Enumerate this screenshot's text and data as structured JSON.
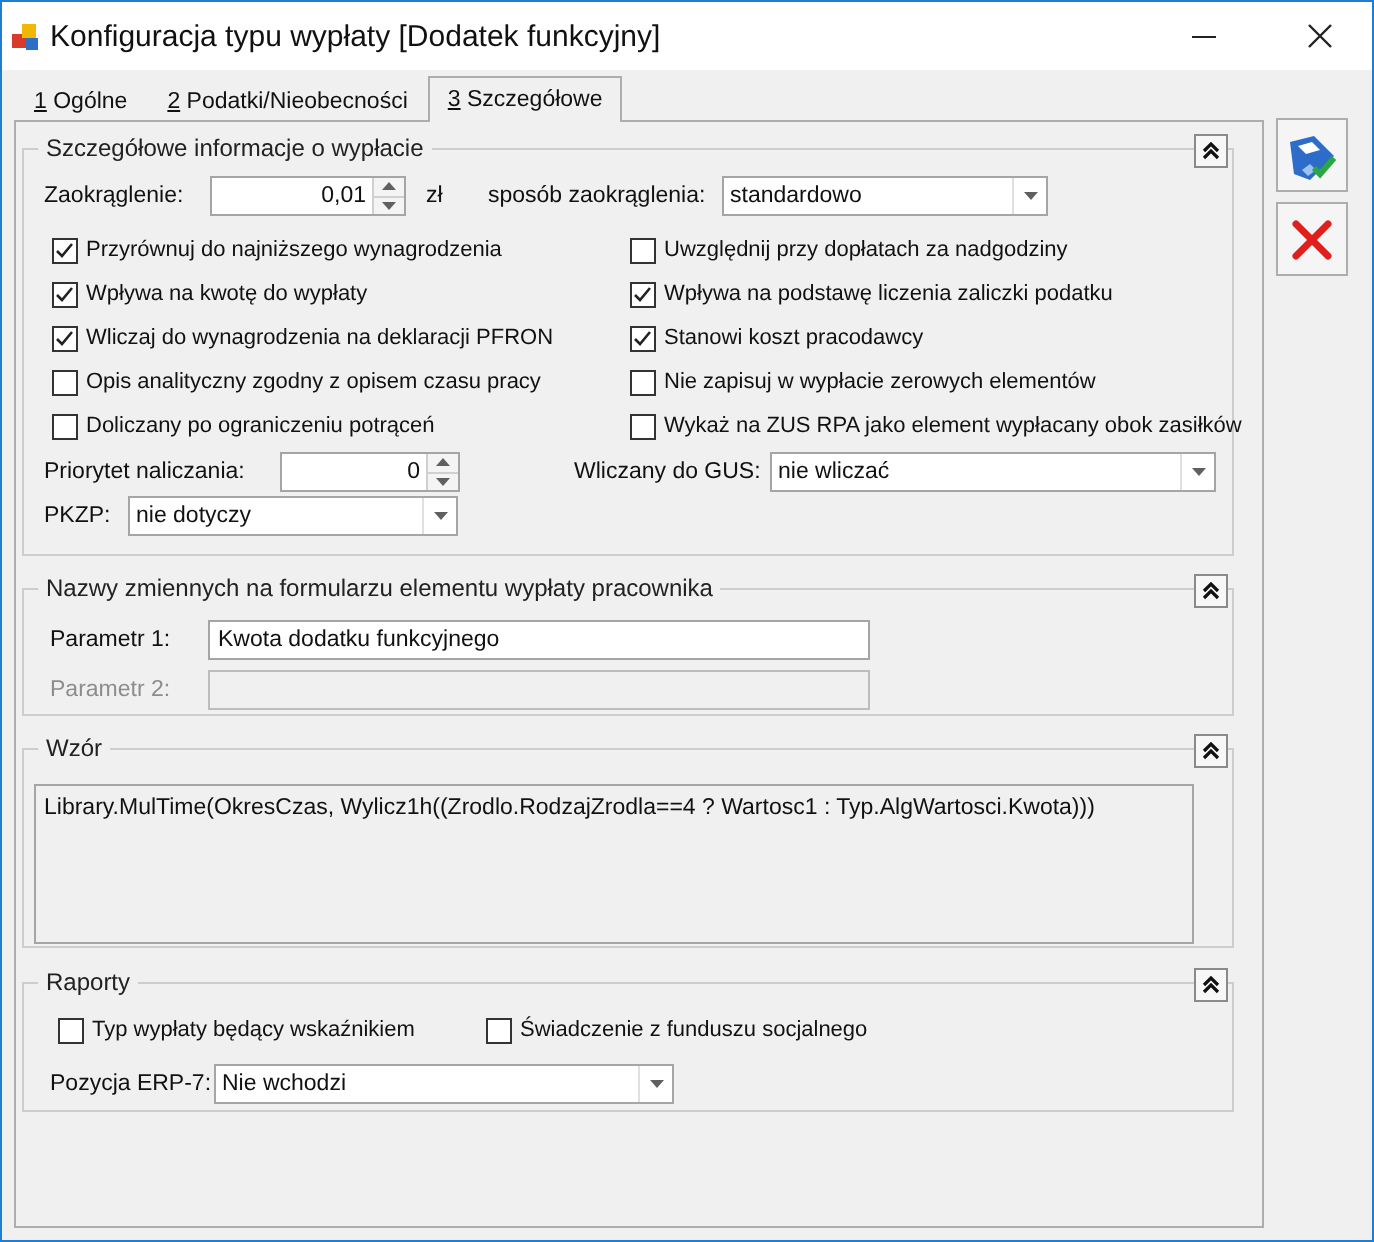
{
  "window": {
    "title": "Konfiguracja typu wypłaty [Dodatek funkcyjny]"
  },
  "tabs": [
    {
      "key": "1",
      "label": "Ogólne",
      "selected": false
    },
    {
      "key": "2",
      "label": "Podatki/Nieobecności",
      "selected": false
    },
    {
      "key": "3",
      "label": "Szczegółowe",
      "selected": true
    }
  ],
  "details": {
    "title": "Szczegółowe informacje o wypłacie",
    "rounding": {
      "label": "Zaokrąglenie:",
      "value": "0,01",
      "unit": "zł"
    },
    "rounding_mode": {
      "label": "sposób zaokrąglenia:",
      "value": "standardowo"
    },
    "options": [
      {
        "label": "Przyrównuj do najniższego wynagrodzenia",
        "checked": true
      },
      {
        "label": "Uwzględnij przy dopłatach za nadgodziny",
        "checked": false
      },
      {
        "label": "Wpływa na kwotę do wypłaty",
        "checked": true
      },
      {
        "label": "Wpływa na podstawę liczenia zaliczki podatku",
        "checked": true
      },
      {
        "label": "Wliczaj do wynagrodzenia na deklaracji PFRON",
        "checked": true
      },
      {
        "label": "Stanowi koszt pracodawcy",
        "checked": true
      },
      {
        "label": "Opis analityczny zgodny z opisem czasu pracy",
        "checked": false
      },
      {
        "label": "Nie zapisuj w wypłacie zerowych elementów",
        "checked": false
      },
      {
        "label": "Doliczany po ograniczeniu potrąceń",
        "checked": false
      },
      {
        "label": "Wykaż na ZUS RPA jako element wypłacany obok zasiłków",
        "checked": false
      }
    ],
    "priority": {
      "label": "Priorytet naliczania:",
      "value": "0"
    },
    "gus": {
      "label": "Wliczany do GUS:",
      "value": "nie wliczać"
    },
    "pkzp": {
      "label": "PKZP:",
      "value": "nie dotyczy"
    }
  },
  "variables": {
    "title": "Nazwy zmiennych na formularzu elementu wypłaty pracownika",
    "params": [
      {
        "label": "Parametr 1:",
        "value": "Kwota dodatku funkcyjnego",
        "disabled": false
      },
      {
        "label": "Parametr 2:",
        "disabled": true
      }
    ]
  },
  "formula": {
    "title": "Wzór",
    "text": "Library.MulTime(OkresCzas, Wylicz1h((Zrodlo.RodzajZrodla==4 ? Wartosc1 : Typ.AlgWartosci.Kwota)))"
  },
  "reports": {
    "title": "Raporty",
    "options": [
      {
        "label": "Typ wypłaty będący wskaźnikiem",
        "checked": false
      },
      {
        "label": "Świadczenie z funduszu socjalnego",
        "checked": false
      }
    ],
    "erp7": {
      "label": "Pozycja ERP-7:",
      "value": "Nie wchodzi"
    }
  }
}
